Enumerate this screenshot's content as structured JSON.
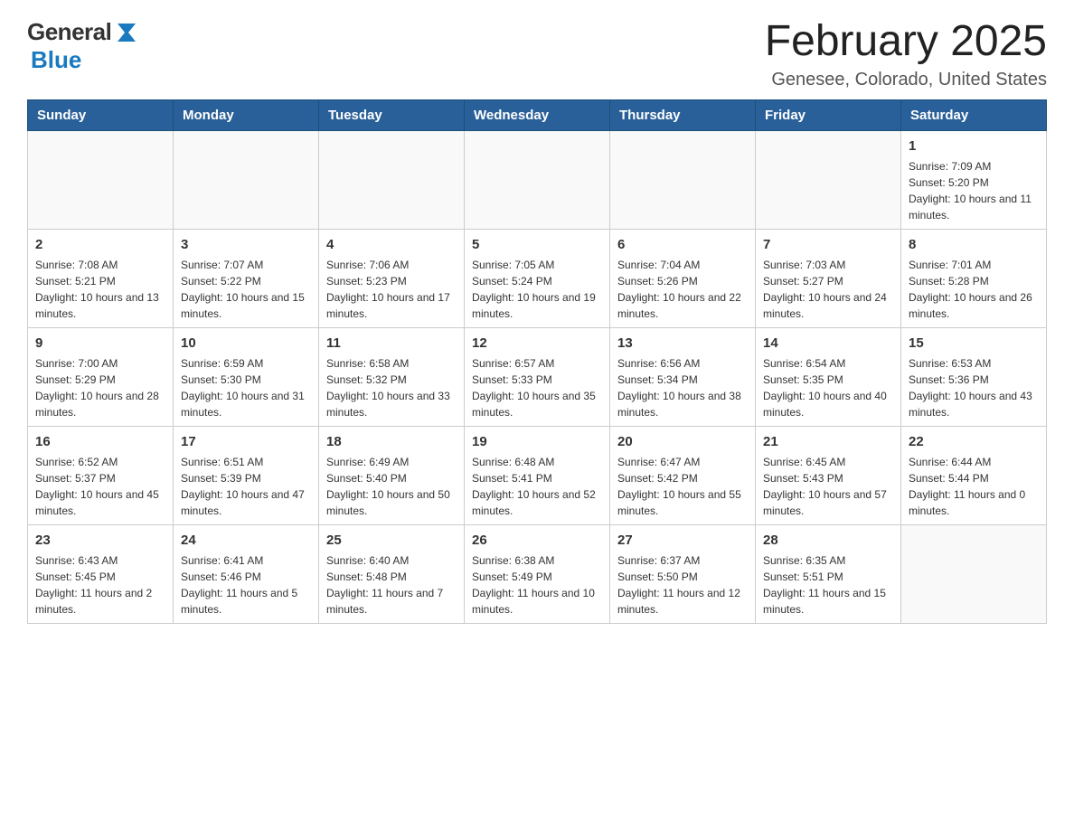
{
  "logo": {
    "general": "General",
    "blue": "Blue"
  },
  "header": {
    "month_year": "February 2025",
    "location": "Genesee, Colorado, United States"
  },
  "weekdays": [
    "Sunday",
    "Monday",
    "Tuesday",
    "Wednesday",
    "Thursday",
    "Friday",
    "Saturday"
  ],
  "weeks": [
    [
      {
        "day": "",
        "info": ""
      },
      {
        "day": "",
        "info": ""
      },
      {
        "day": "",
        "info": ""
      },
      {
        "day": "",
        "info": ""
      },
      {
        "day": "",
        "info": ""
      },
      {
        "day": "",
        "info": ""
      },
      {
        "day": "1",
        "info": "Sunrise: 7:09 AM\nSunset: 5:20 PM\nDaylight: 10 hours and 11 minutes."
      }
    ],
    [
      {
        "day": "2",
        "info": "Sunrise: 7:08 AM\nSunset: 5:21 PM\nDaylight: 10 hours and 13 minutes."
      },
      {
        "day": "3",
        "info": "Sunrise: 7:07 AM\nSunset: 5:22 PM\nDaylight: 10 hours and 15 minutes."
      },
      {
        "day": "4",
        "info": "Sunrise: 7:06 AM\nSunset: 5:23 PM\nDaylight: 10 hours and 17 minutes."
      },
      {
        "day": "5",
        "info": "Sunrise: 7:05 AM\nSunset: 5:24 PM\nDaylight: 10 hours and 19 minutes."
      },
      {
        "day": "6",
        "info": "Sunrise: 7:04 AM\nSunset: 5:26 PM\nDaylight: 10 hours and 22 minutes."
      },
      {
        "day": "7",
        "info": "Sunrise: 7:03 AM\nSunset: 5:27 PM\nDaylight: 10 hours and 24 minutes."
      },
      {
        "day": "8",
        "info": "Sunrise: 7:01 AM\nSunset: 5:28 PM\nDaylight: 10 hours and 26 minutes."
      }
    ],
    [
      {
        "day": "9",
        "info": "Sunrise: 7:00 AM\nSunset: 5:29 PM\nDaylight: 10 hours and 28 minutes."
      },
      {
        "day": "10",
        "info": "Sunrise: 6:59 AM\nSunset: 5:30 PM\nDaylight: 10 hours and 31 minutes."
      },
      {
        "day": "11",
        "info": "Sunrise: 6:58 AM\nSunset: 5:32 PM\nDaylight: 10 hours and 33 minutes."
      },
      {
        "day": "12",
        "info": "Sunrise: 6:57 AM\nSunset: 5:33 PM\nDaylight: 10 hours and 35 minutes."
      },
      {
        "day": "13",
        "info": "Sunrise: 6:56 AM\nSunset: 5:34 PM\nDaylight: 10 hours and 38 minutes."
      },
      {
        "day": "14",
        "info": "Sunrise: 6:54 AM\nSunset: 5:35 PM\nDaylight: 10 hours and 40 minutes."
      },
      {
        "day": "15",
        "info": "Sunrise: 6:53 AM\nSunset: 5:36 PM\nDaylight: 10 hours and 43 minutes."
      }
    ],
    [
      {
        "day": "16",
        "info": "Sunrise: 6:52 AM\nSunset: 5:37 PM\nDaylight: 10 hours and 45 minutes."
      },
      {
        "day": "17",
        "info": "Sunrise: 6:51 AM\nSunset: 5:39 PM\nDaylight: 10 hours and 47 minutes."
      },
      {
        "day": "18",
        "info": "Sunrise: 6:49 AM\nSunset: 5:40 PM\nDaylight: 10 hours and 50 minutes."
      },
      {
        "day": "19",
        "info": "Sunrise: 6:48 AM\nSunset: 5:41 PM\nDaylight: 10 hours and 52 minutes."
      },
      {
        "day": "20",
        "info": "Sunrise: 6:47 AM\nSunset: 5:42 PM\nDaylight: 10 hours and 55 minutes."
      },
      {
        "day": "21",
        "info": "Sunrise: 6:45 AM\nSunset: 5:43 PM\nDaylight: 10 hours and 57 minutes."
      },
      {
        "day": "22",
        "info": "Sunrise: 6:44 AM\nSunset: 5:44 PM\nDaylight: 11 hours and 0 minutes."
      }
    ],
    [
      {
        "day": "23",
        "info": "Sunrise: 6:43 AM\nSunset: 5:45 PM\nDaylight: 11 hours and 2 minutes."
      },
      {
        "day": "24",
        "info": "Sunrise: 6:41 AM\nSunset: 5:46 PM\nDaylight: 11 hours and 5 minutes."
      },
      {
        "day": "25",
        "info": "Sunrise: 6:40 AM\nSunset: 5:48 PM\nDaylight: 11 hours and 7 minutes."
      },
      {
        "day": "26",
        "info": "Sunrise: 6:38 AM\nSunset: 5:49 PM\nDaylight: 11 hours and 10 minutes."
      },
      {
        "day": "27",
        "info": "Sunrise: 6:37 AM\nSunset: 5:50 PM\nDaylight: 11 hours and 12 minutes."
      },
      {
        "day": "28",
        "info": "Sunrise: 6:35 AM\nSunset: 5:51 PM\nDaylight: 11 hours and 15 minutes."
      },
      {
        "day": "",
        "info": ""
      }
    ]
  ]
}
